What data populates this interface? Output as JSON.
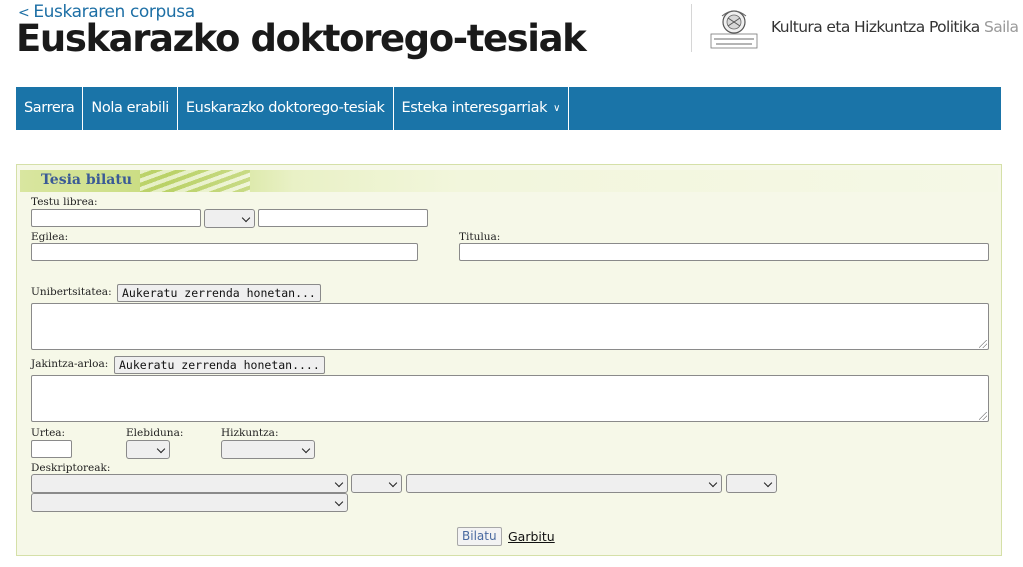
{
  "header": {
    "back_link": "Euskararen corpusa",
    "back_chevron": "<",
    "title": "Euskarazko doktorego-tesiak",
    "department": "Kultura eta Hizkuntza Politika",
    "department_suffix": "Saila",
    "logo_icon": "basque-government-seal-icon"
  },
  "nav": {
    "items": [
      {
        "label": "Sarrera"
      },
      {
        "label": "Nola erabili"
      },
      {
        "label": "Euskarazko doktorego-tesiak"
      },
      {
        "label": "Esteka interesgarriak",
        "has_dropdown": true
      }
    ]
  },
  "search": {
    "title": "Tesia bilatu",
    "free_text_label": "Testu librea:",
    "author_label": "Egilea:",
    "title_label": "Titulua:",
    "university_label": "Unibertsitatea:",
    "university_button": "Aukeratu zerrenda honetan...",
    "field_label": "Jakintza-arloa:",
    "field_button": "Aukeratu zerrenda honetan....",
    "year_label": "Urtea:",
    "bilingual_label": "Elebiduna:",
    "language_label": "Hizkuntza:",
    "descriptors_label": "Deskriptoreak:",
    "submit_label": "Bilatu",
    "clear_label": "Garbitu"
  },
  "colors": {
    "nav_background": "#1a74a8",
    "link_blue": "#1d6fa5",
    "panel_background": "#f6f8e8",
    "panel_title": "#3a5a96"
  }
}
